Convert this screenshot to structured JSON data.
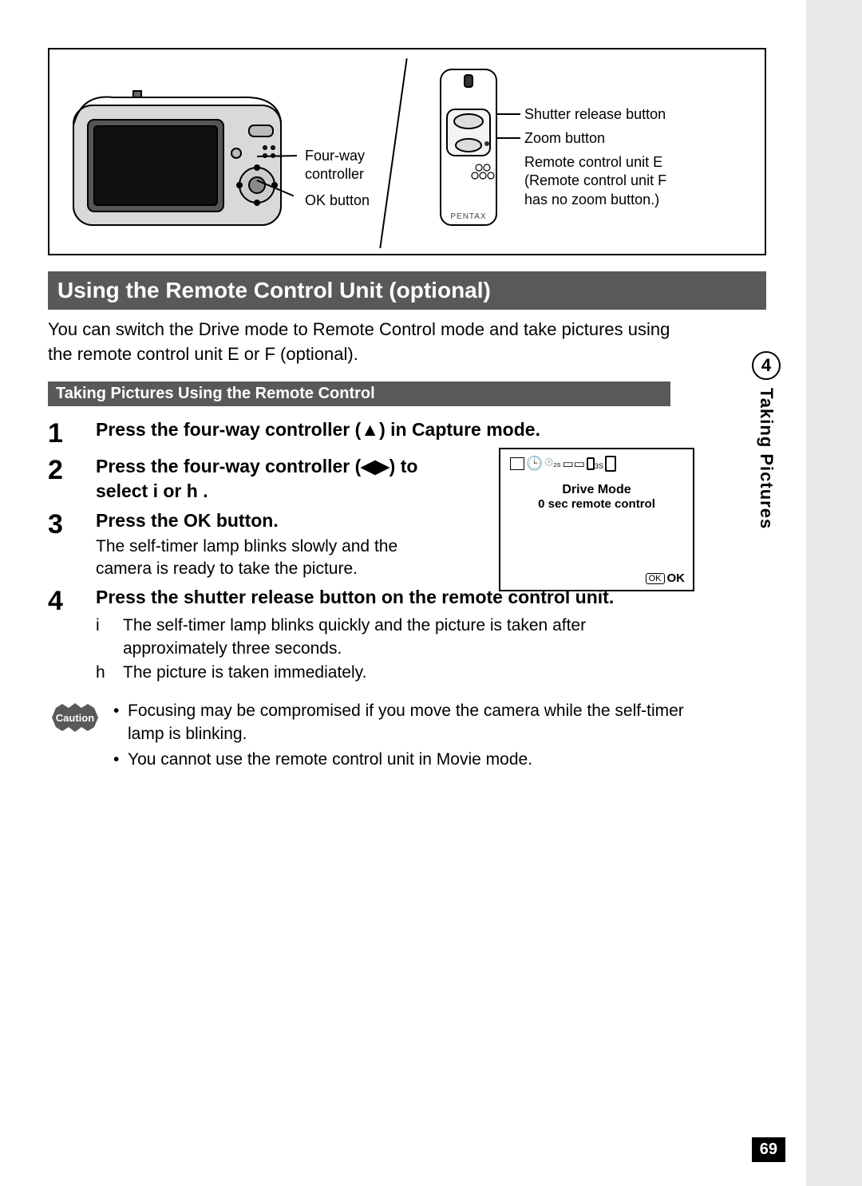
{
  "diagram": {
    "labels": {
      "fourway": "Four-way\ncontroller",
      "okbutton": "OK button",
      "shutter": "Shutter release button",
      "zoom": "Zoom button",
      "remote_unit": "Remote control unit E\n(Remote control unit F\nhas no zoom button.)"
    },
    "remote_brand": "PENTAX"
  },
  "section_title": "Using the Remote Control Unit (optional)",
  "intro": "You can switch the Drive mode to Remote Control mode and take pictures using the remote control unit E or F (optional).",
  "sub_section_title": "Taking Pictures Using the Remote Control",
  "steps": [
    {
      "num": "1",
      "title": "Press the four-way controller (▲) in Capture mode."
    },
    {
      "num": "2",
      "title": "Press the four-way controller (◀▶) to select i   or h ."
    },
    {
      "num": "3",
      "title": "Press the OK button.",
      "desc": "The self-timer lamp blinks slowly and the camera is ready to take the picture."
    },
    {
      "num": "4",
      "title": "Press the shutter release button on the remote control unit.",
      "sub": [
        {
          "k": "i",
          "v": "The self-timer lamp blinks quickly and the picture is taken after approximately three seconds."
        },
        {
          "k": "h",
          "v": "The picture is taken immediately."
        }
      ]
    }
  ],
  "lcd": {
    "title": "Drive Mode",
    "subtitle": "0 sec remote control",
    "ok_label": "OK",
    "ok_box": "OK",
    "icon_text_2s": "2S",
    "icon_text_3s": "3S"
  },
  "caution": {
    "badge": "Caution",
    "items": [
      "Focusing may be compromised if you move the camera while the self-timer lamp is blinking.",
      "You cannot use the remote control unit in Movie mode."
    ]
  },
  "side": {
    "chapter": "4",
    "label": "Taking Pictures"
  },
  "page_number": "69"
}
